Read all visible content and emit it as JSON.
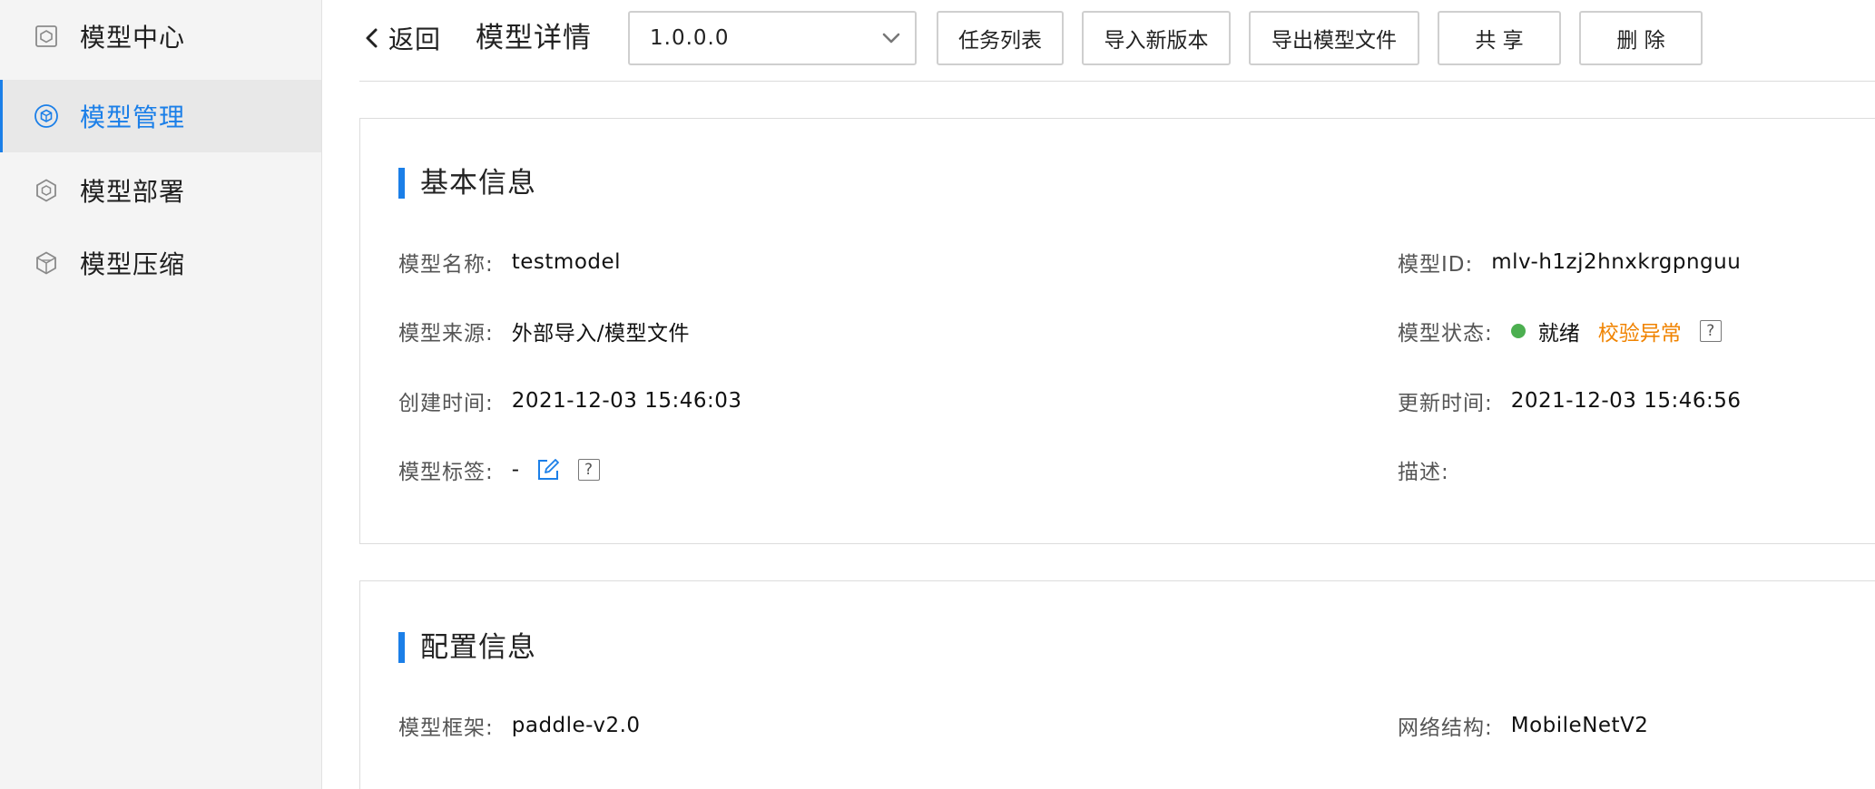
{
  "sidebar": {
    "items": [
      {
        "label": "模型中心",
        "icon": "model-center-icon",
        "active": false
      },
      {
        "label": "模型管理",
        "icon": "model-manage-icon",
        "active": true
      },
      {
        "label": "模型部署",
        "icon": "model-deploy-icon",
        "active": false
      },
      {
        "label": "模型压缩",
        "icon": "model-compress-icon",
        "active": false
      }
    ]
  },
  "header": {
    "back_label": "返回",
    "title": "模型详情",
    "version_selected": "1.0.0.0",
    "buttons": {
      "task_list": "任务列表",
      "import_version": "导入新版本",
      "export_file": "导出模型文件",
      "share": "共 享",
      "delete": "删 除"
    }
  },
  "basic_info": {
    "title": "基本信息",
    "model_name": {
      "label": "模型名称:",
      "value": "testmodel"
    },
    "model_id": {
      "label": "模型ID:",
      "value": "mlv-h1zj2hnxkrgpnguu"
    },
    "model_source": {
      "label": "模型来源:",
      "value": "外部导入/模型文件"
    },
    "model_status": {
      "label": "模型状态:",
      "ready": "就绪",
      "warning": "校验异常"
    },
    "created_at": {
      "label": "创建时间:",
      "value": "2021-12-03 15:46:03"
    },
    "updated_at": {
      "label": "更新时间:",
      "value": "2021-12-03 15:46:56"
    },
    "model_tags": {
      "label": "模型标签:",
      "value": "-"
    },
    "description": {
      "label": "描述:",
      "value": ""
    }
  },
  "config_info": {
    "title": "配置信息",
    "framework": {
      "label": "模型框架:",
      "value": "paddle-v2.0"
    },
    "network": {
      "label": "网络结构:",
      "value": "MobileNetV2"
    }
  },
  "colors": {
    "accent": "#1b7fe8",
    "status_ready": "#4caf50",
    "status_warning": "#f08300",
    "sidebar_bg": "#f4f4f4"
  },
  "help_glyph": "?"
}
